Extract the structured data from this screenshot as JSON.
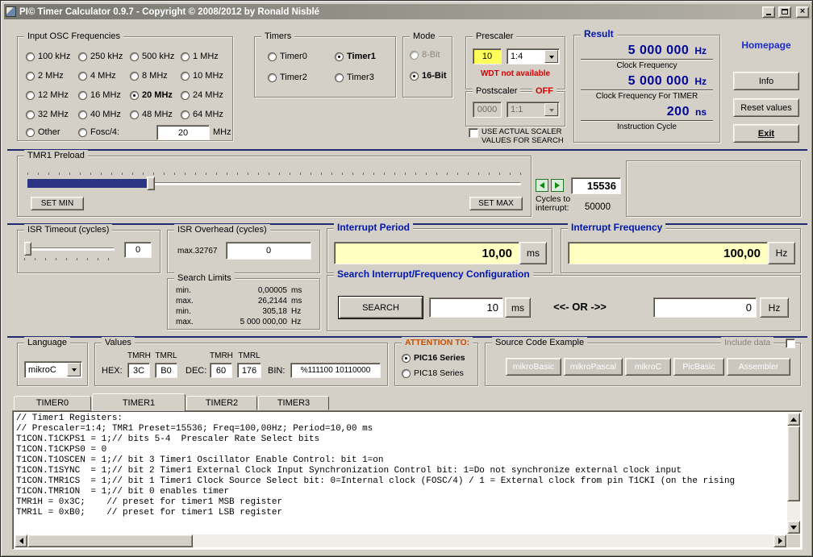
{
  "window": {
    "title": "PI© Timer Calculator 0.9.7 - Copyright © 2008/2012 by Ronald Nisblé"
  },
  "osc": {
    "title": "Input OSC Frequencies",
    "options": [
      "100 kHz",
      "250 kHz",
      "500 kHz",
      "1 MHz",
      "2 MHz",
      "4 MHz",
      "8 MHz",
      "10 MHz",
      "12 MHz",
      "16 MHz",
      "20 MHz",
      "24 MHz",
      "32 MHz",
      "40 MHz",
      "48 MHz",
      "64 MHz"
    ],
    "selected": "20 MHz",
    "other_label": "Other",
    "fosc_label": "Fosc/4:",
    "other_value": "20",
    "other_unit": "MHz"
  },
  "timers": {
    "title": "Timers",
    "options": [
      "Timer0",
      "Timer1",
      "Timer2",
      "Timer3"
    ],
    "selected": "Timer1"
  },
  "mode": {
    "title": "Mode",
    "options": [
      "8-Bit",
      "16-Bit"
    ],
    "selected": "16-Bit"
  },
  "prescaler": {
    "title": "Prescaler",
    "value": "10",
    "ratio": "1:4",
    "note": "WDT not available"
  },
  "postscaler": {
    "title": "Postscaler",
    "state": "OFF",
    "value": "0000",
    "ratio": "1:1"
  },
  "scaler_checkbox": "USE ACTUAL SCALER VALUES FOR SEARCH",
  "result": {
    "title": "Result",
    "items": [
      {
        "value": "5 000 000",
        "unit": "Hz",
        "label": "Clock Frequency"
      },
      {
        "value": "5 000 000",
        "unit": "Hz",
        "label": "Clock Frequency For TIMER"
      },
      {
        "value": "200",
        "unit": "ns",
        "label": "Instruction Cycle"
      }
    ]
  },
  "nav": {
    "homepage": "Homepage",
    "info": "Info",
    "reset": "Reset values",
    "exit": "Exit"
  },
  "preload": {
    "title": "TMR1 Preload",
    "set_min": "SET MIN",
    "set_max": "SET MAX",
    "value": "15536",
    "cycles_label": "Cycles to interrupt:",
    "cycles_value": "50000"
  },
  "isr_timeout": {
    "title": "ISR Timeout (cycles)",
    "value": "0"
  },
  "isr_overhead": {
    "title": "ISR Overhead (cycles)",
    "max_label": "max.32767",
    "value": "0"
  },
  "interrupt_period": {
    "title": "Interrupt Period",
    "value": "10,00",
    "unit": "ms"
  },
  "interrupt_frequency": {
    "title": "Interrupt Frequency",
    "value": "100,00",
    "unit": "Hz"
  },
  "search_limits": {
    "title": "Search Limits",
    "rows": [
      {
        "label": "min.",
        "value": "0,00005",
        "unit": "ms"
      },
      {
        "label": "max.",
        "value": "26,2144",
        "unit": "ms"
      },
      {
        "label": "min.",
        "value": "305,18",
        "unit": "Hz"
      },
      {
        "label": "max.",
        "value": "5 000 000,00",
        "unit": "Hz"
      }
    ]
  },
  "search": {
    "title": "Search Interrupt/Frequency Configuration",
    "button": "SEARCH",
    "period_value": "10",
    "period_unit": "ms",
    "or_text": "<<-  OR  ->>",
    "freq_value": "0",
    "freq_unit": "Hz"
  },
  "language": {
    "title": "Language",
    "selected": "mikroC"
  },
  "values": {
    "title": "Values",
    "headers": [
      "TMRH",
      "TMRL",
      "TMRH",
      "TMRL"
    ],
    "hex_label": "HEX:",
    "hex": [
      "3C",
      "B0"
    ],
    "dec_label": "DEC:",
    "dec": [
      "60",
      "176"
    ],
    "bin_label": "BIN:",
    "bin": "%111100 10110000"
  },
  "attention": {
    "title": "ATTENTION TO:",
    "options": [
      "PIC16 Series",
      "PIC18 Series"
    ],
    "selected": "PIC16 Series"
  },
  "source": {
    "title": "Source Code Example",
    "include_label": "Include data",
    "buttons": [
      "mikroBasic",
      "mikroPascal",
      "mikroC",
      "PicBasic",
      "Assembler"
    ]
  },
  "tabs": [
    "TIMER0",
    "TIMER1",
    "TIMER2",
    "TIMER3"
  ],
  "code": "// Timer1 Registers:\n// Prescaler=1:4; TMR1 Preset=15536; Freq=100,00Hz; Period=10,00 ms\nT1CON.T1CKPS1 = 1;// bits 5-4  Prescaler Rate Select bits\nT1CON.T1CKPS0 = 0\nT1CON.T1OSCEN = 1;// bit 3 Timer1 Oscillator Enable Control: bit 1=on\nT1CON.T1SYNC  = 1;// bit 2 Timer1 External Clock Input Synchronization Control bit: 1=Do not synchronize external clock input\nT1CON.TMR1CS  = 1;// bit 1 Timer1 Clock Source Select bit: 0=Internal clock (FOSC/4) / 1 = External clock from pin T1CKI (on the rising\nT1CON.TMR1ON  = 1;// bit 0 enables timer\nTMR1H = 0x3C;    // preset for timer1 MSB register\nTMR1L = 0xB0;    // preset for timer1 LSB register",
  "colors": {
    "accent_blue": "#0016b0",
    "alert_red": "#d40000",
    "attention_orange": "#c85000",
    "field_yellow": "#ffffc2",
    "slider_fill": "#2a3584"
  }
}
